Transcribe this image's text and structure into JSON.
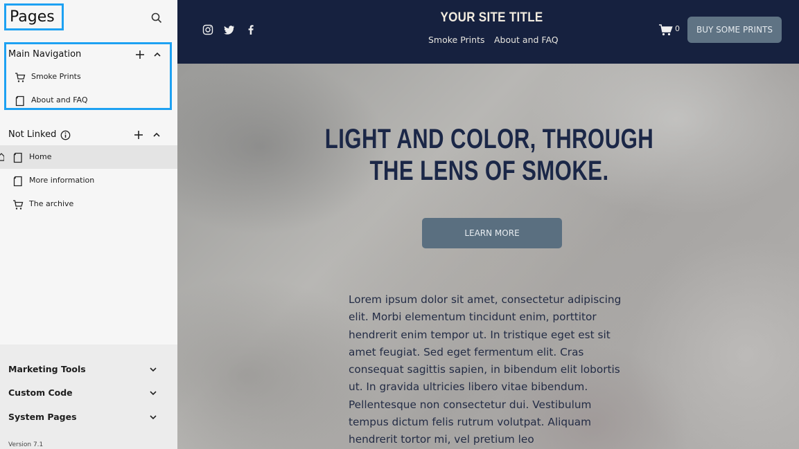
{
  "sidebar": {
    "title": "Pages",
    "main_navigation": {
      "label": "Main Navigation",
      "items": [
        {
          "label": "Smoke Prints",
          "icon": "cart-icon"
        },
        {
          "label": "About and FAQ",
          "icon": "page-icon"
        }
      ]
    },
    "not_linked": {
      "label": "Not Linked",
      "items": [
        {
          "label": "Home",
          "icon": "page-icon",
          "is_homepage": true
        },
        {
          "label": "More information",
          "icon": "page-icon"
        },
        {
          "label": "The archive",
          "icon": "cart-icon"
        }
      ]
    },
    "accordions": [
      {
        "label": "Marketing Tools"
      },
      {
        "label": "Custom Code"
      },
      {
        "label": "System Pages"
      }
    ],
    "version": "Version 7.1"
  },
  "site": {
    "title": "YOUR SITE TITLE",
    "nav": [
      "Smoke Prints",
      "About and FAQ"
    ],
    "social_icons": [
      "instagram-icon",
      "twitter-icon",
      "facebook-icon"
    ],
    "cart_count": "0",
    "cta_label": "BUY SOME PRINTS",
    "hero": {
      "headline": "LIGHT AND COLOR, THROUGH THE LENS OF SMOKE.",
      "button_label": "LEARN MORE",
      "body": "Lorem ipsum dolor sit amet, consectetur adipiscing elit. Morbi elementum tincidunt enim, porttitor hendrerit enim tempor ut. In tristique eget est sit amet feugiat. Sed eget fermentum elit. Cras consequat sagittis sapien, in bibendum elit lobortis ut. In gravida ultricies libero vitae bibendum. Pellentesque non consectetur dui. Vestibulum tempus dictum felis rutrum volutpat. Aliquam hendrerit tortor mi, vel pretium leo"
    }
  },
  "colors": {
    "highlight": "#1da1f2",
    "site_header": "#16213f",
    "headline": "#1b2747",
    "button": "#5f7384"
  }
}
